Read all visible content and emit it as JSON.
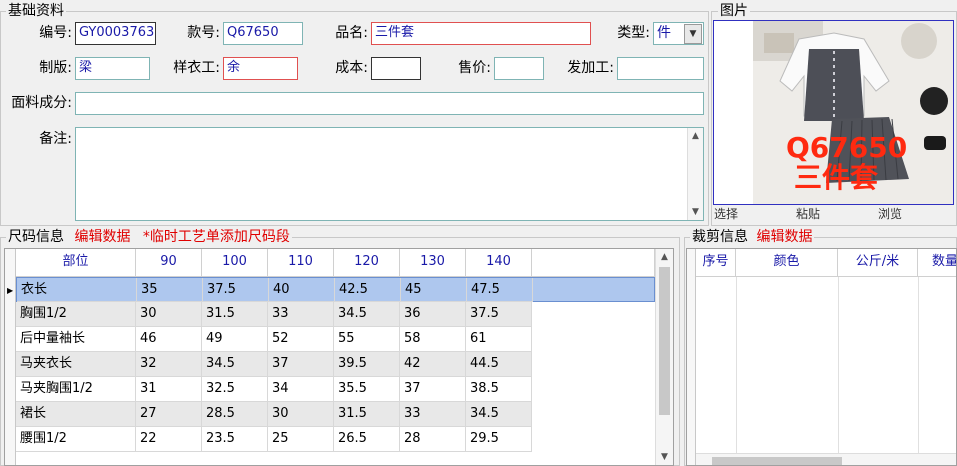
{
  "basic": {
    "legend": "基础资料",
    "code_label": "编号:",
    "code_value": "GY0003763",
    "style_label": "款号:",
    "style_value": "Q67650",
    "name_label": "品名:",
    "name_value": "三件套",
    "type_label": "类型:",
    "type_value": "件",
    "pattern_label": "制版:",
    "pattern_value": "梁",
    "sample_label": "样衣工:",
    "sample_value": "余",
    "cost_label": "成本:",
    "cost_value": "",
    "price_label": "售价:",
    "price_value": "",
    "process_label": "发加工:",
    "process_value": "",
    "fabric_label": "面料成分:",
    "fabric_value": "",
    "remark_label": "备注:",
    "remark_value": ""
  },
  "photo": {
    "legend": "图片",
    "overlay_code": "Q67650",
    "overlay_name": "三件套",
    "select_label": "选择",
    "paste_label": "粘贴",
    "browse_label": "浏览"
  },
  "size": {
    "legend": "尺码信息",
    "edit_label": "编辑数据",
    "note": "*临时工艺单添加尺码段",
    "columns": [
      "部位",
      "90",
      "100",
      "110",
      "120",
      "130",
      "140"
    ],
    "rows": [
      [
        "衣长",
        "35",
        "37.5",
        "40",
        "42.5",
        "45",
        "47.5"
      ],
      [
        "胸围1/2",
        "30",
        "31.5",
        "33",
        "34.5",
        "36",
        "37.5"
      ],
      [
        "后中量袖长",
        "46",
        "49",
        "52",
        "55",
        "58",
        "61"
      ],
      [
        "马夹衣长",
        "32",
        "34.5",
        "37",
        "39.5",
        "42",
        "44.5"
      ],
      [
        "马夹胸围1/2",
        "31",
        "32.5",
        "34",
        "35.5",
        "37",
        "38.5"
      ],
      [
        "裙长",
        "27",
        "28.5",
        "30",
        "31.5",
        "33",
        "34.5"
      ],
      [
        "腰围1/2",
        "22",
        "23.5",
        "25",
        "26.5",
        "28",
        "29.5"
      ]
    ]
  },
  "cut": {
    "legend": "裁剪信息",
    "edit_label": "编辑数据",
    "columns": [
      "序号",
      "颜色",
      "公斤/米",
      "数量"
    ]
  }
}
